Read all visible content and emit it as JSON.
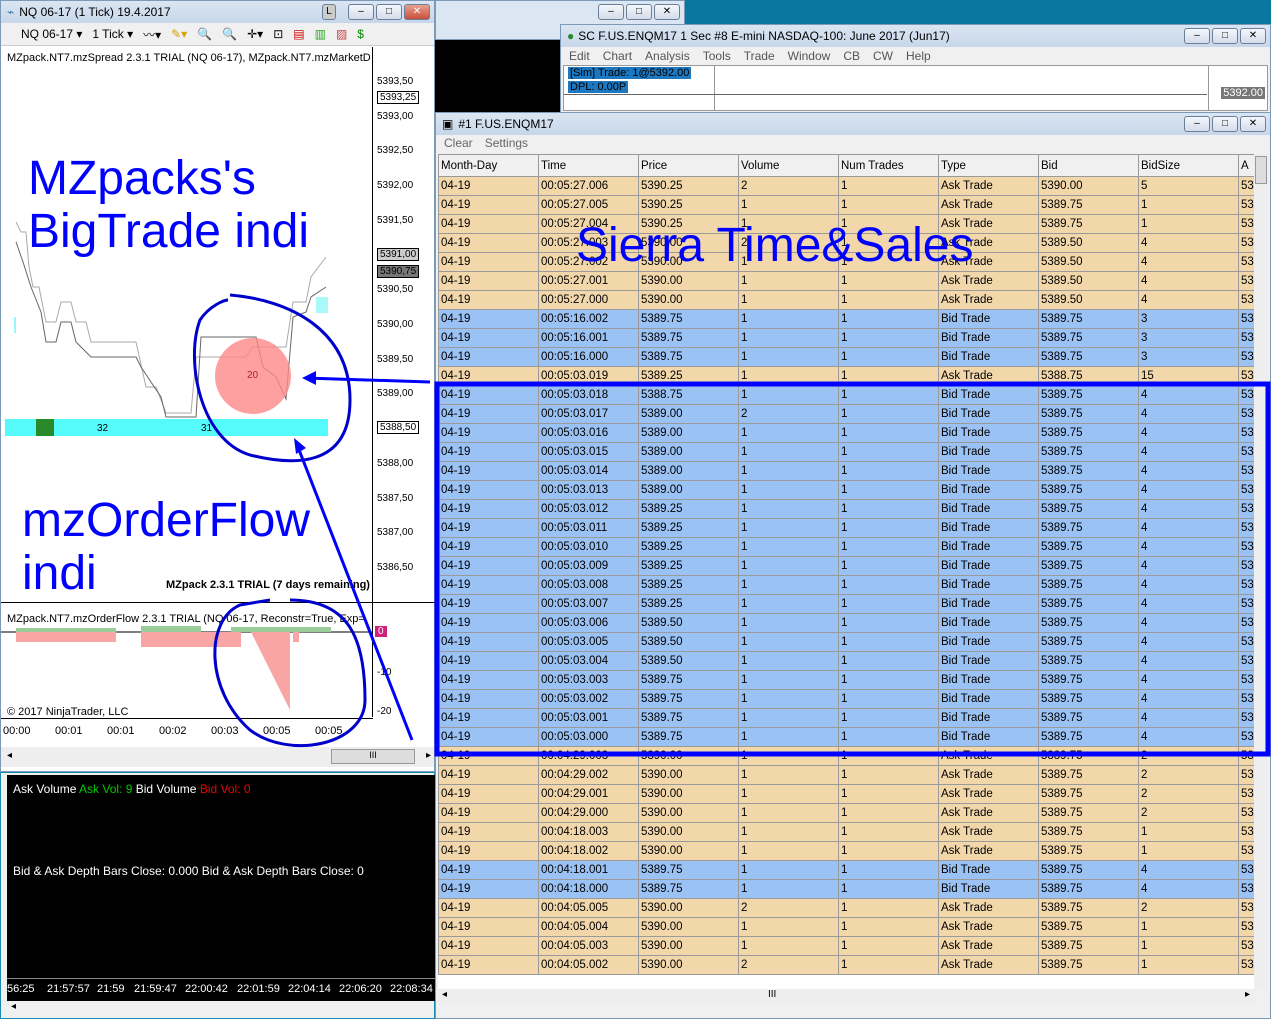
{
  "ninja": {
    "title": "NQ 06-17 (1 Tick)  19.4.2017",
    "l_btn": "L",
    "instrument": "NQ 06-17",
    "interval": "1 Tick",
    "indicator_label": "MZpack.NT7.mzSpread 2.3.1 TRIAL (NQ 06-17), MZpack.NT7.mzMarketD",
    "price_ticks": [
      "5393,50",
      "5393,00",
      "5392,50",
      "5392,00",
      "5391,50",
      "5390,50",
      "5390,00",
      "5389,50",
      "5389,00",
      "5388,00",
      "5387,50",
      "5387,00",
      "5386,50"
    ],
    "price_tags": {
      "high": "5393,25",
      "ask": "5391,00",
      "last": "5390,75",
      "low": "5388,50"
    },
    "bigtrade_value": "20",
    "depth_values": [
      "32",
      "31"
    ],
    "trial_label": "MZpack 2.3.1 TRIAL  (7 days remaining)",
    "orderflow_label": "MZpack.NT7.mzOrderFlow 2.3.1 TRIAL (NQ 06-17, Reconstr=True, Exp=",
    "of_ticks": [
      "-10",
      "-20"
    ],
    "of_tag": "0",
    "copyright": "© 2017 NinjaTrader, LLC",
    "time_ticks": [
      "00:00",
      "00:01",
      "00:01",
      "00:02",
      "00:03",
      "00:05",
      "00:05"
    ],
    "scroll_grip": "III"
  },
  "volwin": {
    "ask_label": "Ask Volume",
    "ask_val": "Ask Vol: 9",
    "bid_label": "Bid Volume",
    "bid_val": "Bid Vol: 0",
    "depth_label": "Bid & Ask Depth Bars  Close: 0.000  Bid & Ask Depth Bars  Close: 0",
    "time_ticks": [
      "56:25",
      "21:57:57",
      "21:59",
      "21:59:47",
      "22:00:42",
      "22:01:59",
      "22:04:14",
      "22:06:20",
      "22:08:34"
    ]
  },
  "sierra": {
    "title": "SC F.US.ENQM17  1 Sec   #8  E-mini NASDAQ-100: June 2017 (Jun17)",
    "menu": [
      "Edit",
      "Chart",
      "Analysis",
      "Tools",
      "Trade",
      "Window",
      "CB",
      "CW",
      "Help"
    ],
    "trade_info": "[Sim]  Trade: 1@5392.00",
    "dpl": "DPL: 0.00P",
    "price_tag": "5392.00"
  },
  "ts": {
    "title": "#1 F.US.ENQM17",
    "menu": [
      "Clear",
      "Settings"
    ],
    "columns": [
      "Month-Day",
      "Time",
      "Price",
      "Volume",
      "Num Trades",
      "Type",
      "Bid",
      "BidSize",
      "A"
    ],
    "rows": [
      [
        "04-19",
        "00:05:27.006",
        "5390.25",
        "2",
        "1",
        "Ask Trade",
        "5390.00",
        "5",
        "53"
      ],
      [
        "04-19",
        "00:05:27.005",
        "5390.25",
        "1",
        "1",
        "Ask Trade",
        "5389.75",
        "1",
        "53"
      ],
      [
        "04-19",
        "00:05:27.004",
        "5390.25",
        "1",
        "1",
        "Ask Trade",
        "5389.75",
        "1",
        "53"
      ],
      [
        "04-19",
        "00:05:27.003",
        "5390.00",
        "2",
        "1",
        "Ask Trade",
        "5389.50",
        "4",
        "53"
      ],
      [
        "04-19",
        "00:05:27.002",
        "5390.00",
        "1",
        "1",
        "Ask Trade",
        "5389.50",
        "4",
        "53"
      ],
      [
        "04-19",
        "00:05:27.001",
        "5390.00",
        "1",
        "1",
        "Ask Trade",
        "5389.50",
        "4",
        "53"
      ],
      [
        "04-19",
        "00:05:27.000",
        "5390.00",
        "1",
        "1",
        "Ask Trade",
        "5389.50",
        "4",
        "53"
      ],
      [
        "04-19",
        "00:05:16.002",
        "5389.75",
        "1",
        "1",
        "Bid Trade",
        "5389.75",
        "3",
        "53"
      ],
      [
        "04-19",
        "00:05:16.001",
        "5389.75",
        "1",
        "1",
        "Bid Trade",
        "5389.75",
        "3",
        "53"
      ],
      [
        "04-19",
        "00:05:16.000",
        "5389.75",
        "1",
        "1",
        "Bid Trade",
        "5389.75",
        "3",
        "53"
      ],
      [
        "04-19",
        "00:05:03.019",
        "5389.25",
        "1",
        "1",
        "Ask Trade",
        "5388.75",
        "15",
        "53"
      ],
      [
        "04-19",
        "00:05:03.018",
        "5388.75",
        "1",
        "1",
        "Bid Trade",
        "5389.75",
        "4",
        "53"
      ],
      [
        "04-19",
        "00:05:03.017",
        "5389.00",
        "2",
        "1",
        "Bid Trade",
        "5389.75",
        "4",
        "53"
      ],
      [
        "04-19",
        "00:05:03.016",
        "5389.00",
        "1",
        "1",
        "Bid Trade",
        "5389.75",
        "4",
        "53"
      ],
      [
        "04-19",
        "00:05:03.015",
        "5389.00",
        "1",
        "1",
        "Bid Trade",
        "5389.75",
        "4",
        "53"
      ],
      [
        "04-19",
        "00:05:03.014",
        "5389.00",
        "1",
        "1",
        "Bid Trade",
        "5389.75",
        "4",
        "53"
      ],
      [
        "04-19",
        "00:05:03.013",
        "5389.00",
        "1",
        "1",
        "Bid Trade",
        "5389.75",
        "4",
        "53"
      ],
      [
        "04-19",
        "00:05:03.012",
        "5389.25",
        "1",
        "1",
        "Bid Trade",
        "5389.75",
        "4",
        "53"
      ],
      [
        "04-19",
        "00:05:03.011",
        "5389.25",
        "1",
        "1",
        "Bid Trade",
        "5389.75",
        "4",
        "53"
      ],
      [
        "04-19",
        "00:05:03.010",
        "5389.25",
        "1",
        "1",
        "Bid Trade",
        "5389.75",
        "4",
        "53"
      ],
      [
        "04-19",
        "00:05:03.009",
        "5389.25",
        "1",
        "1",
        "Bid Trade",
        "5389.75",
        "4",
        "53"
      ],
      [
        "04-19",
        "00:05:03.008",
        "5389.25",
        "1",
        "1",
        "Bid Trade",
        "5389.75",
        "4",
        "53"
      ],
      [
        "04-19",
        "00:05:03.007",
        "5389.25",
        "1",
        "1",
        "Bid Trade",
        "5389.75",
        "4",
        "53"
      ],
      [
        "04-19",
        "00:05:03.006",
        "5389.50",
        "1",
        "1",
        "Bid Trade",
        "5389.75",
        "4",
        "53"
      ],
      [
        "04-19",
        "00:05:03.005",
        "5389.50",
        "1",
        "1",
        "Bid Trade",
        "5389.75",
        "4",
        "53"
      ],
      [
        "04-19",
        "00:05:03.004",
        "5389.50",
        "1",
        "1",
        "Bid Trade",
        "5389.75",
        "4",
        "53"
      ],
      [
        "04-19",
        "00:05:03.003",
        "5389.75",
        "1",
        "1",
        "Bid Trade",
        "5389.75",
        "4",
        "53"
      ],
      [
        "04-19",
        "00:05:03.002",
        "5389.75",
        "1",
        "1",
        "Bid Trade",
        "5389.75",
        "4",
        "53"
      ],
      [
        "04-19",
        "00:05:03.001",
        "5389.75",
        "1",
        "1",
        "Bid Trade",
        "5389.75",
        "4",
        "53"
      ],
      [
        "04-19",
        "00:05:03.000",
        "5389.75",
        "1",
        "1",
        "Bid Trade",
        "5389.75",
        "4",
        "53"
      ],
      [
        "04-19",
        "00:04:29.003",
        "5390.00",
        "1",
        "1",
        "Ask Trade",
        "5389.75",
        "2",
        "53"
      ],
      [
        "04-19",
        "00:04:29.002",
        "5390.00",
        "1",
        "1",
        "Ask Trade",
        "5389.75",
        "2",
        "53"
      ],
      [
        "04-19",
        "00:04:29.001",
        "5390.00",
        "1",
        "1",
        "Ask Trade",
        "5389.75",
        "2",
        "53"
      ],
      [
        "04-19",
        "00:04:29.000",
        "5390.00",
        "1",
        "1",
        "Ask Trade",
        "5389.75",
        "2",
        "53"
      ],
      [
        "04-19",
        "00:04:18.003",
        "5390.00",
        "1",
        "1",
        "Ask Trade",
        "5389.75",
        "1",
        "53"
      ],
      [
        "04-19",
        "00:04:18.002",
        "5390.00",
        "1",
        "1",
        "Ask Trade",
        "5389.75",
        "1",
        "53"
      ],
      [
        "04-19",
        "00:04:18.001",
        "5389.75",
        "1",
        "1",
        "Bid Trade",
        "5389.75",
        "4",
        "53"
      ],
      [
        "04-19",
        "00:04:18.000",
        "5389.75",
        "1",
        "1",
        "Bid Trade",
        "5389.75",
        "4",
        "53"
      ],
      [
        "04-19",
        "00:04:05.005",
        "5390.00",
        "2",
        "1",
        "Ask Trade",
        "5389.75",
        "2",
        "53"
      ],
      [
        "04-19",
        "00:04:05.004",
        "5390.00",
        "1",
        "1",
        "Ask Trade",
        "5389.75",
        "1",
        "53"
      ],
      [
        "04-19",
        "00:04:05.003",
        "5390.00",
        "1",
        "1",
        "Ask Trade",
        "5389.75",
        "1",
        "53"
      ],
      [
        "04-19",
        "00:04:05.002",
        "5390.00",
        "2",
        "1",
        "Ask Trade",
        "5389.75",
        "1",
        "53"
      ]
    ],
    "scroll_grip": "III"
  },
  "annotations": {
    "bigtrade": "MZpacks's\nBigTrade indi",
    "orderflow": "mzOrderFlow\nindi",
    "sierra": "Sierra Time&Sales"
  },
  "colors": {
    "ask_row": "#f2d7ab",
    "bid_row": "#9bc2f5",
    "annotation": "#0000ff"
  }
}
